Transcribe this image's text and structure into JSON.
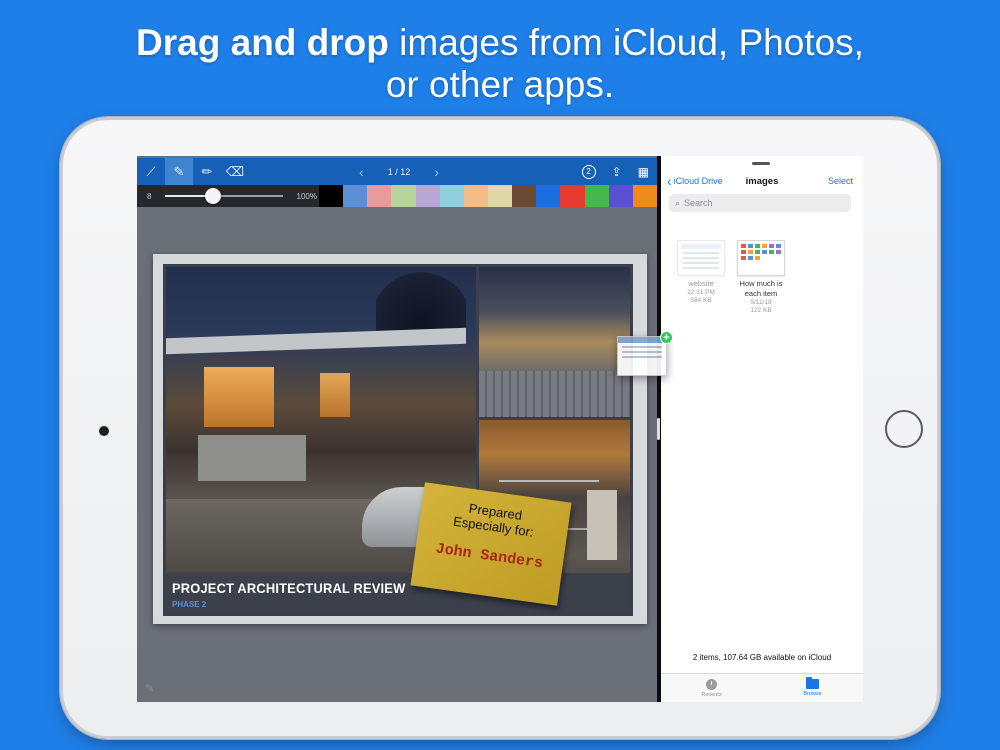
{
  "headline": {
    "bold": "Drag and drop",
    "rest": " images from iCloud, Photos,",
    "line2": "or other apps."
  },
  "editor": {
    "tools": [
      {
        "icon": "brush-icon",
        "glyph": "⟋",
        "active": false
      },
      {
        "icon": "pen-icon",
        "glyph": "✎",
        "active": true
      },
      {
        "icon": "pencil-icon",
        "glyph": "✏",
        "active": false
      },
      {
        "icon": "eraser-icon",
        "glyph": "⌫",
        "active": false
      }
    ],
    "page_indicator": "1 / 12",
    "prev_glyph": "‹",
    "next_glyph": "›",
    "badge_count": "2",
    "share_glyph": "⇪",
    "grid_glyph": "▦",
    "size_value": "8",
    "opacity_label": "100%",
    "opacity_level": 0.41,
    "swatch_colors": [
      "#000000",
      "#5b8fd6",
      "#e99a9a",
      "#b7d49a",
      "#b7a6d6",
      "#8fcfe0",
      "#f4bd86",
      "#e0d9a6",
      "#6b4a36",
      "#1a6fe0",
      "#e63c2e",
      "#45b84c",
      "#5b4fd6",
      "#f08a1c"
    ],
    "slide": {
      "title": "PROJECT ARCHITECTURAL REVIEW",
      "subtitle": "PHASE 2"
    },
    "sticky_note": {
      "line1": "Prepared",
      "line2": "Especially for:",
      "name": "John Sanders"
    }
  },
  "files_app": {
    "back_label": "iCloud Drive",
    "title": "images",
    "select_label": "Select",
    "search_placeholder": "Search",
    "files": [
      {
        "name": "website",
        "date": "12:31 PM",
        "size": "584 KB"
      },
      {
        "name": "How much is each item",
        "date": "5/11/18",
        "size": "122 KB"
      }
    ],
    "footer": "2 items, 107.64 GB available on iCloud",
    "tabs": [
      {
        "label": "Recents",
        "icon": "clock-icon"
      },
      {
        "label": "Browse",
        "icon": "folder-icon"
      }
    ]
  },
  "colors": {
    "background": "#1f7fe8",
    "toolbar": "#1660b8",
    "accent": "#1a73e8",
    "sticky": "#cfad33",
    "drop_plus": "#35c75a"
  }
}
